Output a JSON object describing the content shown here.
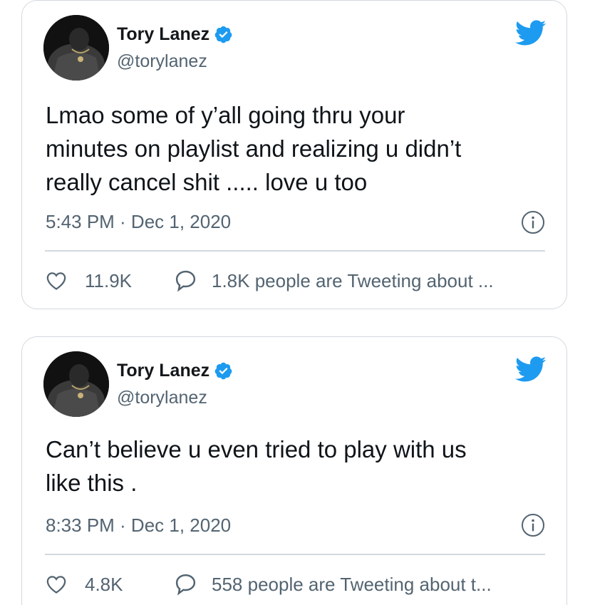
{
  "tweets": [
    {
      "author": {
        "display_name": "Tory Lanez",
        "handle": "@torylanez",
        "verified": true
      },
      "text": "Lmao some of y’all going thru your\nminutes on playlist and realizing u didn’t\nreally cancel shit ..... love u too",
      "timestamp": "5:43 PM · Dec 1, 2020",
      "likes": "11.9K",
      "tweeting_about": "1.8K people are Tweeting about ..."
    },
    {
      "author": {
        "display_name": "Tory Lanez",
        "handle": "@torylanez",
        "verified": true
      },
      "text": "Can’t believe u even tried to play with us\nlike this .",
      "timestamp": "8:33 PM · Dec 1, 2020",
      "likes": "4.8K",
      "tweeting_about": "558 people are Tweeting about t..."
    }
  ],
  "icons": {
    "verified": "verified-badge-icon",
    "brand": "twitter-bird-icon",
    "info": "info-icon",
    "like": "heart-icon",
    "reply": "speech-bubble-icon"
  },
  "colors": {
    "twitter_blue": "#1d9bf0",
    "secondary_text": "#536471",
    "border": "#d3d9de"
  }
}
